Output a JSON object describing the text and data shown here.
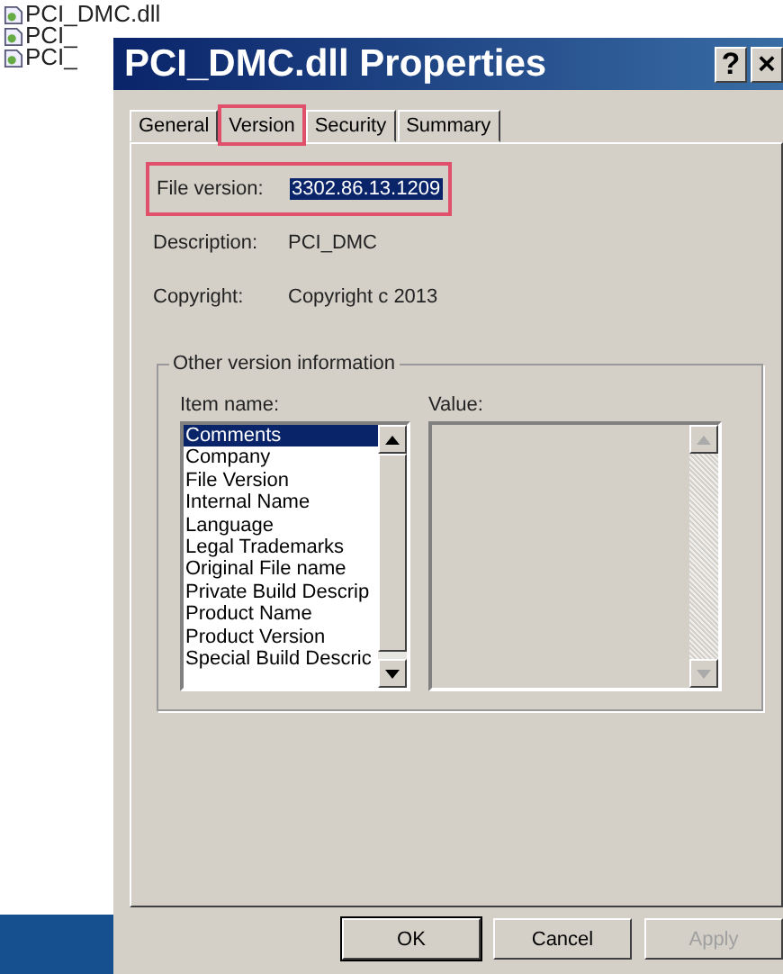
{
  "desktop_files": [
    {
      "name": "PCI_DMC.dll"
    },
    {
      "name": "PCI_"
    },
    {
      "name": "PCI_"
    }
  ],
  "window": {
    "title": "PCI_DMC.dll Properties",
    "help": "?",
    "close": "×"
  },
  "tabs": [
    {
      "label": "General",
      "selected": false,
      "highlighted": false
    },
    {
      "label": "Version",
      "selected": true,
      "highlighted": true
    },
    {
      "label": "Security",
      "selected": false,
      "highlighted": false
    },
    {
      "label": "Summary",
      "selected": false,
      "highlighted": false
    }
  ],
  "fields": [
    {
      "label": "File version:",
      "value": "3302.86.13.1209",
      "value_selected": true,
      "highlighted": true
    },
    {
      "label": "Description:",
      "value": "PCI_DMC",
      "value_selected": false,
      "highlighted": false
    },
    {
      "label": "Copyright:",
      "value": "Copyright c 2013",
      "value_selected": false,
      "highlighted": false
    }
  ],
  "other_info": {
    "title": "Other version information",
    "item_label": "Item name:",
    "value_label": "Value:",
    "items": [
      {
        "label": "Comments",
        "selected": true
      },
      {
        "label": "Company",
        "selected": false
      },
      {
        "label": "File Version",
        "selected": false
      },
      {
        "label": "Internal Name",
        "selected": false
      },
      {
        "label": "Language",
        "selected": false
      },
      {
        "label": "Legal Trademarks",
        "selected": false
      },
      {
        "label": "Original File name",
        "selected": false
      },
      {
        "label": "Private Build Descrip",
        "selected": false
      },
      {
        "label": "Product Name",
        "selected": false
      },
      {
        "label": "Product Version",
        "selected": false
      },
      {
        "label": "Special Build Descric",
        "selected": false
      }
    ]
  },
  "buttons": [
    {
      "label": "OK",
      "disabled": false,
      "default": true
    },
    {
      "label": "Cancel",
      "disabled": false,
      "default": false
    },
    {
      "label": "Apply",
      "disabled": true,
      "default": false
    }
  ]
}
